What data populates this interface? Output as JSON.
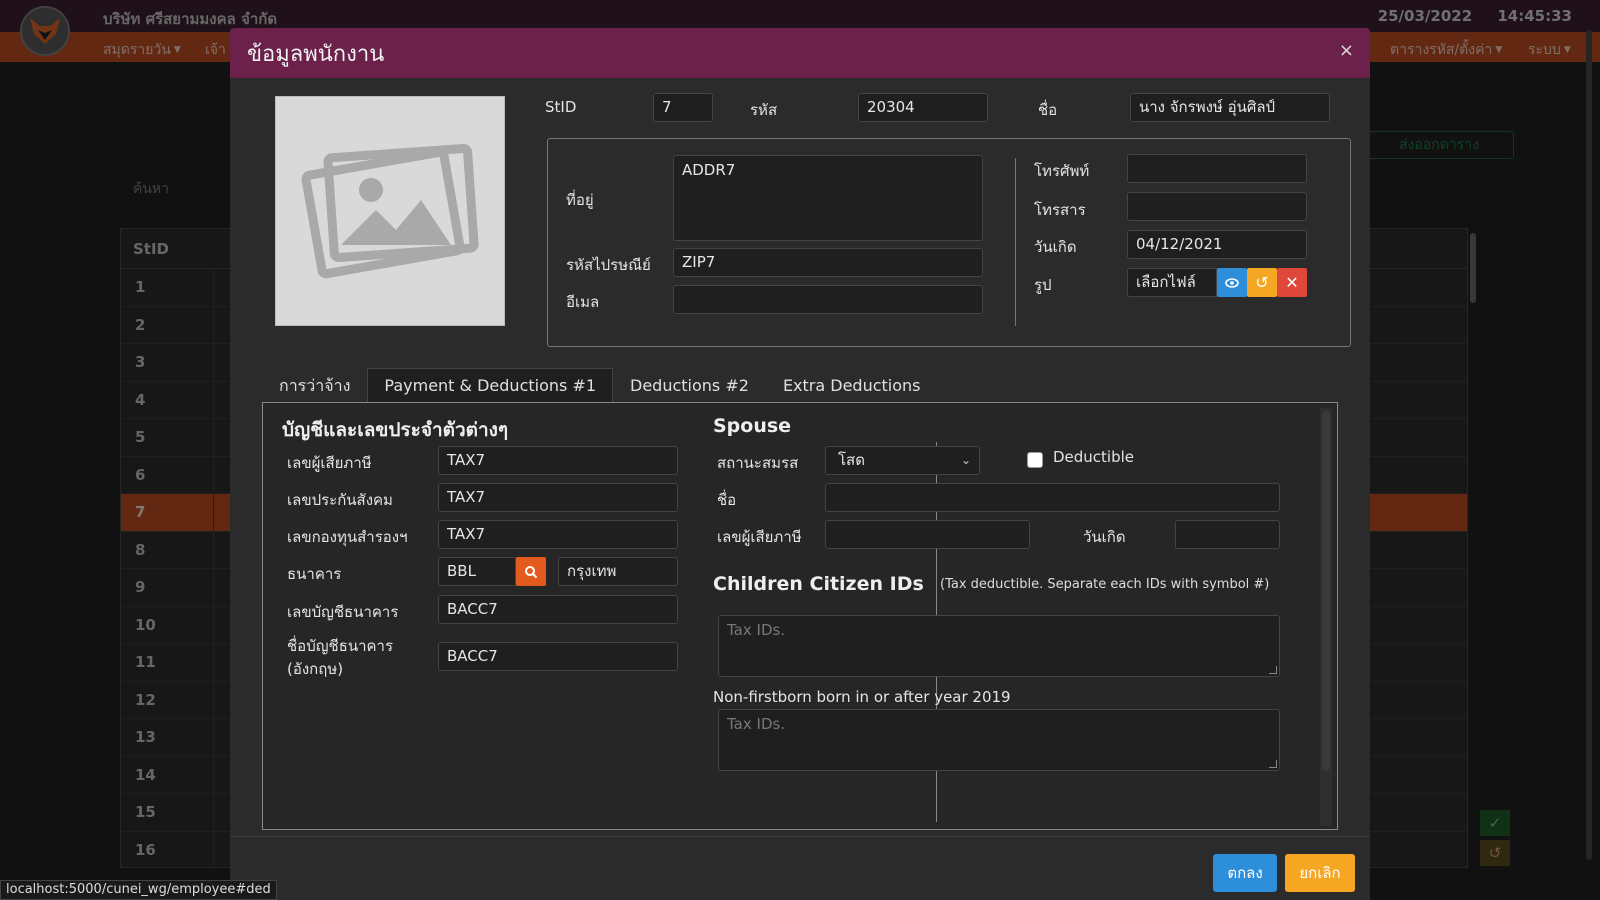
{
  "app": {
    "company": "บริษัท ศรีสยามมงคล จำกัด",
    "date": "25/03/2022",
    "time": "14:45:33",
    "menu": {
      "journal": "สมุดรายวัน",
      "partial": "เจ้า",
      "tables": "ตารางรหัส/ตั้งค่า",
      "system": "ระบบ"
    },
    "export_label": "ส่งออกตาราง",
    "search_placeholder": "ค้นหา",
    "table": {
      "header": "StID",
      "rows": [
        "1",
        "2",
        "3",
        "4",
        "5",
        "6",
        "7",
        "8",
        "9",
        "10",
        "11",
        "12",
        "13",
        "14",
        "15",
        "16"
      ],
      "selected_row": "7"
    },
    "status_url": "localhost:5000/cunei_wg/employee#ded"
  },
  "modal": {
    "title": "ข้อมูลพนักงาน",
    "close_glyph": "×",
    "stid_label": "StID",
    "stid_value": "7",
    "code_label": "รหัส",
    "code_value": "20304",
    "name_label": "ชื่อ",
    "name_value": "นาง จักรพงษ์ อุ่นศิลป์",
    "address_label": "ที่อยู่",
    "address_value": "ADDR7",
    "zip_label": "รหัสไปรษณีย์",
    "zip_value": "ZIP7",
    "email_label": "อีเมล",
    "email_value": "",
    "phone_label": "โทรศัพท์",
    "phone_value": "",
    "fax_label": "โทรสาร",
    "fax_value": "",
    "birthday_label": "วันเกิด",
    "birthday_value": "04/12/2021",
    "photo_label": "รูป",
    "choose_file_label": "เลือกไฟล์",
    "tabs": [
      "การว่าจ้าง",
      "Payment & Deductions #1",
      "Deductions #2",
      "Extra Deductions"
    ],
    "active_tab": "Payment & Deductions #1",
    "accounts": {
      "heading": "บัญชีและเลขประจำตัวต่างๆ",
      "tax_label": "เลขผู้เสียภาษี",
      "tax_value": "TAX7",
      "sso_label": "เลขประกันสังคม",
      "sso_value": "TAX7",
      "fund_label": "เลขกองทุนสำรองฯ",
      "fund_value": "TAX7",
      "bank_label": "ธนาคาร",
      "bank_code": "BBL",
      "bank_name": "กรุงเทพ",
      "bank_account_label": "เลขบัญชีธนาคาร",
      "bank_account_value": "BACC7",
      "bank_account_name_label_1": "ชื่อบัญชีธนาคาร",
      "bank_account_name_label_2": "(อังกฤษ)",
      "bank_account_name_value": "BACC7"
    },
    "spouse": {
      "heading": "Spouse",
      "marital_label": "สถานะสมรส",
      "marital_value": "โสด",
      "deductible_label": "Deductible",
      "deductible_checked": false,
      "name_label": "ชื่อ",
      "name_value": "",
      "tax_label": "เลขผู้เสียภาษี",
      "tax_value": "",
      "birthday_label": "วันเกิด",
      "birthday_value": ""
    },
    "children": {
      "heading": "Children Citizen IDs",
      "note": "(Tax deductible. Separate each IDs with symbol #)",
      "ids_placeholder": "Tax IDs.",
      "nonfirst_label": "Non-firstborn born in or after year 2019",
      "nonfirst_placeholder": "Tax IDs."
    },
    "ok_label": "ตกลง",
    "cancel_label": "ยกเลิก"
  },
  "colors": {
    "header_bg": "#6b2149",
    "accent_orange": "#b54a22",
    "btn_blue": "#2d8fd9",
    "btn_yellow": "#f5a623",
    "btn_red": "#e0473b"
  }
}
